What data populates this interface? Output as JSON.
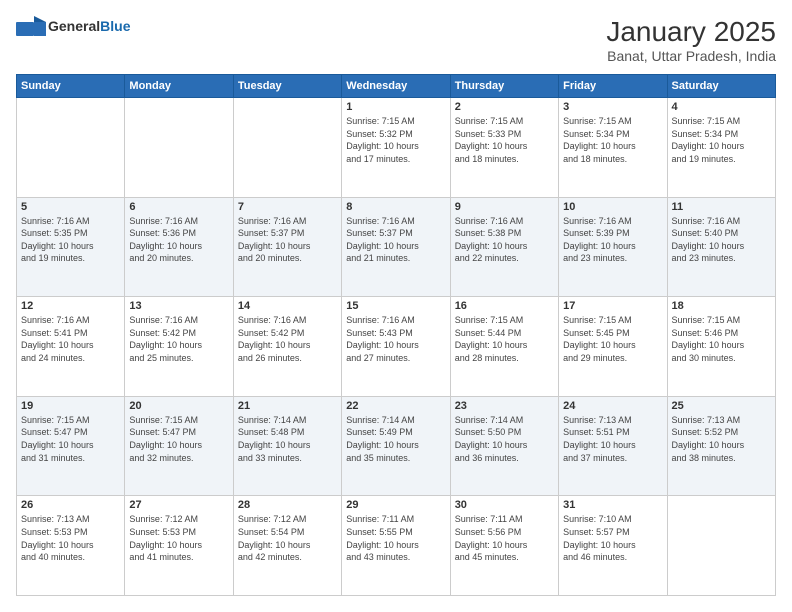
{
  "logo": {
    "general": "General",
    "blue": "Blue"
  },
  "title": "January 2025",
  "subtitle": "Banat, Uttar Pradesh, India",
  "weekdays": [
    "Sunday",
    "Monday",
    "Tuesday",
    "Wednesday",
    "Thursday",
    "Friday",
    "Saturday"
  ],
  "weeks": [
    [
      {
        "day": "",
        "info": ""
      },
      {
        "day": "",
        "info": ""
      },
      {
        "day": "",
        "info": ""
      },
      {
        "day": "1",
        "info": "Sunrise: 7:15 AM\nSunset: 5:32 PM\nDaylight: 10 hours\nand 17 minutes."
      },
      {
        "day": "2",
        "info": "Sunrise: 7:15 AM\nSunset: 5:33 PM\nDaylight: 10 hours\nand 18 minutes."
      },
      {
        "day": "3",
        "info": "Sunrise: 7:15 AM\nSunset: 5:34 PM\nDaylight: 10 hours\nand 18 minutes."
      },
      {
        "day": "4",
        "info": "Sunrise: 7:15 AM\nSunset: 5:34 PM\nDaylight: 10 hours\nand 19 minutes."
      }
    ],
    [
      {
        "day": "5",
        "info": "Sunrise: 7:16 AM\nSunset: 5:35 PM\nDaylight: 10 hours\nand 19 minutes."
      },
      {
        "day": "6",
        "info": "Sunrise: 7:16 AM\nSunset: 5:36 PM\nDaylight: 10 hours\nand 20 minutes."
      },
      {
        "day": "7",
        "info": "Sunrise: 7:16 AM\nSunset: 5:37 PM\nDaylight: 10 hours\nand 20 minutes."
      },
      {
        "day": "8",
        "info": "Sunrise: 7:16 AM\nSunset: 5:37 PM\nDaylight: 10 hours\nand 21 minutes."
      },
      {
        "day": "9",
        "info": "Sunrise: 7:16 AM\nSunset: 5:38 PM\nDaylight: 10 hours\nand 22 minutes."
      },
      {
        "day": "10",
        "info": "Sunrise: 7:16 AM\nSunset: 5:39 PM\nDaylight: 10 hours\nand 23 minutes."
      },
      {
        "day": "11",
        "info": "Sunrise: 7:16 AM\nSunset: 5:40 PM\nDaylight: 10 hours\nand 23 minutes."
      }
    ],
    [
      {
        "day": "12",
        "info": "Sunrise: 7:16 AM\nSunset: 5:41 PM\nDaylight: 10 hours\nand 24 minutes."
      },
      {
        "day": "13",
        "info": "Sunrise: 7:16 AM\nSunset: 5:42 PM\nDaylight: 10 hours\nand 25 minutes."
      },
      {
        "day": "14",
        "info": "Sunrise: 7:16 AM\nSunset: 5:42 PM\nDaylight: 10 hours\nand 26 minutes."
      },
      {
        "day": "15",
        "info": "Sunrise: 7:16 AM\nSunset: 5:43 PM\nDaylight: 10 hours\nand 27 minutes."
      },
      {
        "day": "16",
        "info": "Sunrise: 7:15 AM\nSunset: 5:44 PM\nDaylight: 10 hours\nand 28 minutes."
      },
      {
        "day": "17",
        "info": "Sunrise: 7:15 AM\nSunset: 5:45 PM\nDaylight: 10 hours\nand 29 minutes."
      },
      {
        "day": "18",
        "info": "Sunrise: 7:15 AM\nSunset: 5:46 PM\nDaylight: 10 hours\nand 30 minutes."
      }
    ],
    [
      {
        "day": "19",
        "info": "Sunrise: 7:15 AM\nSunset: 5:47 PM\nDaylight: 10 hours\nand 31 minutes."
      },
      {
        "day": "20",
        "info": "Sunrise: 7:15 AM\nSunset: 5:47 PM\nDaylight: 10 hours\nand 32 minutes."
      },
      {
        "day": "21",
        "info": "Sunrise: 7:14 AM\nSunset: 5:48 PM\nDaylight: 10 hours\nand 33 minutes."
      },
      {
        "day": "22",
        "info": "Sunrise: 7:14 AM\nSunset: 5:49 PM\nDaylight: 10 hours\nand 35 minutes."
      },
      {
        "day": "23",
        "info": "Sunrise: 7:14 AM\nSunset: 5:50 PM\nDaylight: 10 hours\nand 36 minutes."
      },
      {
        "day": "24",
        "info": "Sunrise: 7:13 AM\nSunset: 5:51 PM\nDaylight: 10 hours\nand 37 minutes."
      },
      {
        "day": "25",
        "info": "Sunrise: 7:13 AM\nSunset: 5:52 PM\nDaylight: 10 hours\nand 38 minutes."
      }
    ],
    [
      {
        "day": "26",
        "info": "Sunrise: 7:13 AM\nSunset: 5:53 PM\nDaylight: 10 hours\nand 40 minutes."
      },
      {
        "day": "27",
        "info": "Sunrise: 7:12 AM\nSunset: 5:53 PM\nDaylight: 10 hours\nand 41 minutes."
      },
      {
        "day": "28",
        "info": "Sunrise: 7:12 AM\nSunset: 5:54 PM\nDaylight: 10 hours\nand 42 minutes."
      },
      {
        "day": "29",
        "info": "Sunrise: 7:11 AM\nSunset: 5:55 PM\nDaylight: 10 hours\nand 43 minutes."
      },
      {
        "day": "30",
        "info": "Sunrise: 7:11 AM\nSunset: 5:56 PM\nDaylight: 10 hours\nand 45 minutes."
      },
      {
        "day": "31",
        "info": "Sunrise: 7:10 AM\nSunset: 5:57 PM\nDaylight: 10 hours\nand 46 minutes."
      },
      {
        "day": "",
        "info": ""
      }
    ]
  ]
}
